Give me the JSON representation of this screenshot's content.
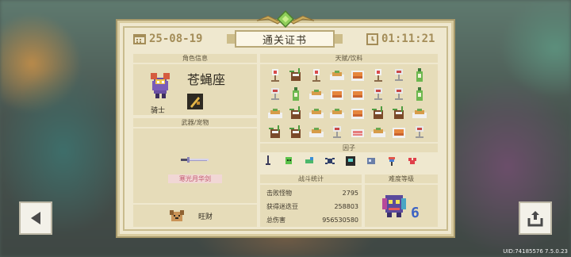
{
  "header": {
    "date": "25-08-19",
    "title": "通关证书",
    "time": "01:11:21"
  },
  "character": {
    "section_label": "角色信息",
    "name": "苍蝇座",
    "role": "骑士"
  },
  "weapon": {
    "section_label": "武器/宠物",
    "name": "寒光月华剑"
  },
  "pet": {
    "name": "旺财"
  },
  "talents": {
    "section_label": "天赋/饮料",
    "items": [
      "red-orb-icon",
      "coconut-drink-icon",
      "red-orb-icon",
      "plate-food-icon",
      "cake-icon",
      "red-orb-icon",
      "goblet-icon",
      "green-bottle-icon",
      "goblet-icon",
      "green-bottle-icon",
      "plate-food-icon",
      "cake-icon",
      "cake-icon",
      "goblet-icon",
      "goblet-icon",
      "green-bottle-icon",
      "plate-food-icon",
      "coconut-drink-icon",
      "plate-food-icon",
      "plate-food-icon",
      "cake-icon",
      "coconut-drink-icon",
      "coconut-drink-icon",
      "plate-food-icon",
      "coconut-drink-icon",
      "coconut-drink-icon",
      "plate-food-icon",
      "goblet-icon",
      "sushi-icon",
      "plate-food-icon",
      "cake-icon",
      "goblet-icon"
    ]
  },
  "factors": {
    "section_label": "因子",
    "items": [
      "sword-icon",
      "green-ghost-icon",
      "bird-icon",
      "spider-icon",
      "robot-box-icon",
      "gear-beast-icon",
      "feather-icon",
      "heart-wing-icon"
    ]
  },
  "battle_stats": {
    "section_label": "战斗统计",
    "rows": [
      {
        "label": "击败怪物",
        "value": "2795"
      },
      {
        "label": "获得迷迭豆",
        "value": "258803"
      },
      {
        "label": "总伤害",
        "value": "956530580"
      }
    ]
  },
  "difficulty": {
    "section_label": "难度等级",
    "level": "6"
  },
  "footer": {
    "uid": "UID:74185576 7.5.0.23"
  },
  "colors": {
    "panel": "#efe8cf",
    "section": "#e6dcb9",
    "accent_blue": "#3d63c4",
    "weapon_name": "#c1556b"
  }
}
